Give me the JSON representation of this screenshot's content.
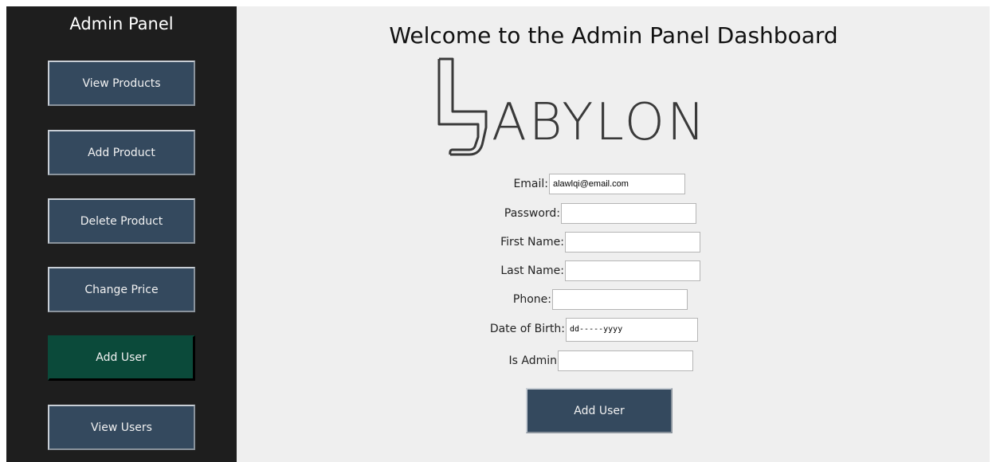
{
  "sidebar": {
    "title": "Admin Panel",
    "items": [
      {
        "label": "View Products"
      },
      {
        "label": "Add Product"
      },
      {
        "label": "Delete Product"
      },
      {
        "label": "Change Price"
      },
      {
        "label": "Add User",
        "active": true
      },
      {
        "label": "View Users"
      }
    ]
  },
  "main": {
    "title": "Welcome to the Admin Panel Dashboard",
    "logo_text": "ABYLON"
  },
  "form": {
    "email": {
      "label": "Email:",
      "value": "alawlqi@email.com"
    },
    "password": {
      "label": "Password:",
      "value": ""
    },
    "first_name": {
      "label": "First Name:",
      "value": ""
    },
    "last_name": {
      "label": "Last Name:",
      "value": ""
    },
    "phone": {
      "label": "Phone:",
      "value": ""
    },
    "dob": {
      "label": "Date of Birth:",
      "value": "dd-----yyyy"
    },
    "is_admin": {
      "label": "Is Admin",
      "value": ""
    },
    "submit_label": "Add User"
  },
  "colors": {
    "sidebar_bg": "#1e1e1e",
    "button_bg": "#34495e",
    "active_button_bg": "#0b4a3a",
    "main_bg": "#efefef"
  }
}
